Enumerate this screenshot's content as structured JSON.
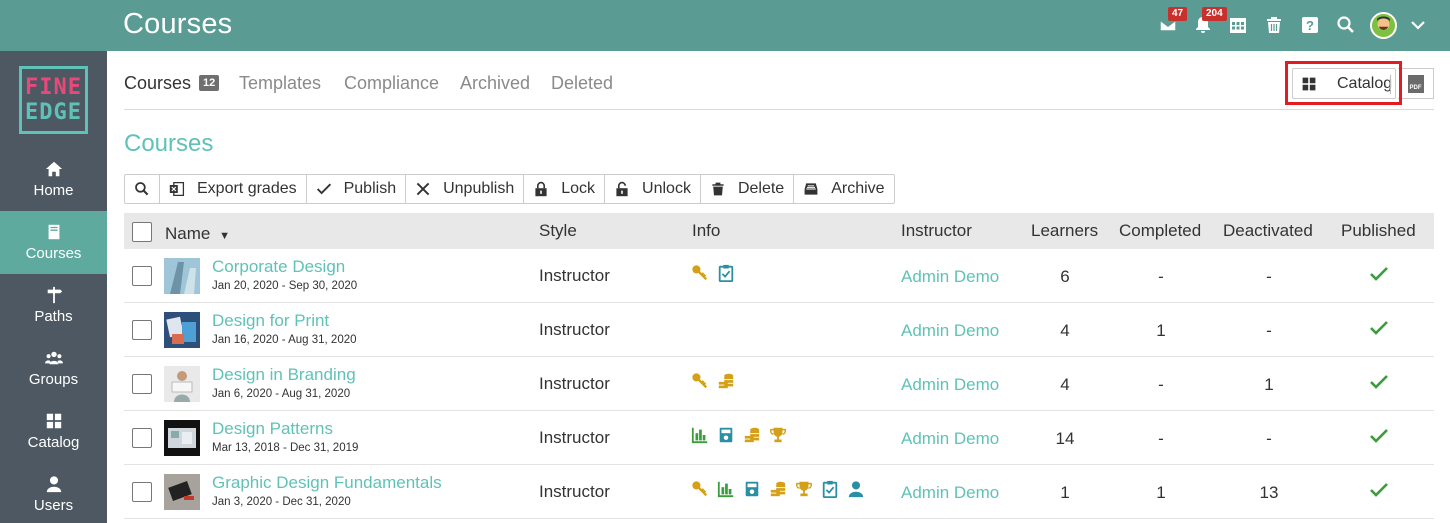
{
  "header": {
    "title": "Courses",
    "messages_badge": "47",
    "notifications_badge": "204"
  },
  "sidebar": {
    "logo_line1": "FINE",
    "logo_line2": "EDGE",
    "items": [
      {
        "label": "Home",
        "icon": "home-icon"
      },
      {
        "label": "Courses",
        "icon": "book-icon",
        "active": true
      },
      {
        "label": "Paths",
        "icon": "signpost-icon"
      },
      {
        "label": "Groups",
        "icon": "group-icon"
      },
      {
        "label": "Catalog",
        "icon": "grid-icon"
      },
      {
        "label": "Users",
        "icon": "user-icon"
      }
    ]
  },
  "tabs": [
    {
      "label": "Courses",
      "count": "12",
      "active": true
    },
    {
      "label": "Templates"
    },
    {
      "label": "Compliance"
    },
    {
      "label": "Archived"
    },
    {
      "label": "Deleted"
    }
  ],
  "catalog_button": "Catalog",
  "pdf_label": "PDF",
  "section_title": "Courses",
  "toolbar": {
    "export_grades": "Export grades",
    "publish": "Publish",
    "unpublish": "Unpublish",
    "lock": "Lock",
    "unlock": "Unlock",
    "delete": "Delete",
    "archive": "Archive"
  },
  "table": {
    "headers": {
      "name": "Name",
      "style": "Style",
      "info": "Info",
      "instructor": "Instructor",
      "learners": "Learners",
      "completed": "Completed",
      "deactivated": "Deactivated",
      "published": "Published"
    },
    "rows": [
      {
        "name": "Corporate Design",
        "dates": "Jan 20, 2020 - Sep 30, 2020",
        "style": "Instructor",
        "info": [
          "key-icon",
          "clipboard-check-icon"
        ],
        "instructor": "Admin Demo",
        "learners": "6",
        "completed": "-",
        "deactivated": "-",
        "published": true
      },
      {
        "name": "Design for Print",
        "dates": "Jan 16, 2020 - Aug 31, 2020",
        "style": "Instructor",
        "info": [],
        "instructor": "Admin Demo",
        "learners": "4",
        "completed": "1",
        "deactivated": "-",
        "published": true
      },
      {
        "name": "Design in Branding",
        "dates": "Jan 6, 2020 - Aug 31, 2020",
        "style": "Instructor",
        "info": [
          "key-icon",
          "coins-icon"
        ],
        "instructor": "Admin Demo",
        "learners": "4",
        "completed": "-",
        "deactivated": "1",
        "published": true
      },
      {
        "name": "Design Patterns",
        "dates": "Mar 13, 2018 - Dec 31, 2019",
        "style": "Instructor",
        "info": [
          "bar-chart-icon",
          "calculator-icon",
          "coins-icon",
          "trophy-icon"
        ],
        "instructor": "Admin Demo",
        "learners": "14",
        "completed": "-",
        "deactivated": "-",
        "published": true
      },
      {
        "name": "Graphic Design Fundamentals",
        "dates": "Jan 3, 2020 - Dec 31, 2020",
        "style": "Instructor",
        "info": [
          "key-icon",
          "bar-chart-icon",
          "calculator-icon",
          "coins-icon",
          "trophy-icon",
          "clipboard-check-icon",
          "person-icon"
        ],
        "instructor": "Admin Demo",
        "learners": "1",
        "completed": "1",
        "deactivated": "13",
        "published": true
      }
    ]
  },
  "colors": {
    "topbar": "#5a9c93",
    "sidebar": "#4d5862",
    "accent": "#5fc2b8",
    "gold": "#d4a017",
    "green": "#3a9c3a",
    "highlight": "#e31b23"
  }
}
